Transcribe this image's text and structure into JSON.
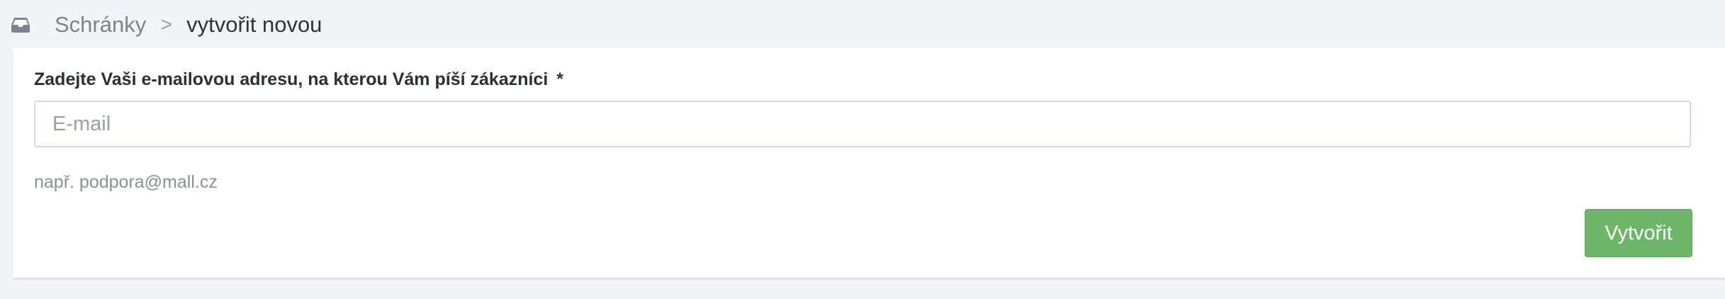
{
  "breadcrumb": {
    "icon": "inbox-icon",
    "root": "Schránky",
    "separator": ">",
    "current": "vytvořit novou"
  },
  "form": {
    "email_label": "Zadejte Vaši e-mailovou adresu, na kterou Vám píší zákazníci",
    "required_marker": "*",
    "email_placeholder": "E-mail",
    "email_value": "",
    "help_text": "např. podpora@mall.cz",
    "submit_label": "Vytvořit"
  },
  "colors": {
    "primary_button": "#6db568",
    "page_background": "#f3f4f6"
  }
}
